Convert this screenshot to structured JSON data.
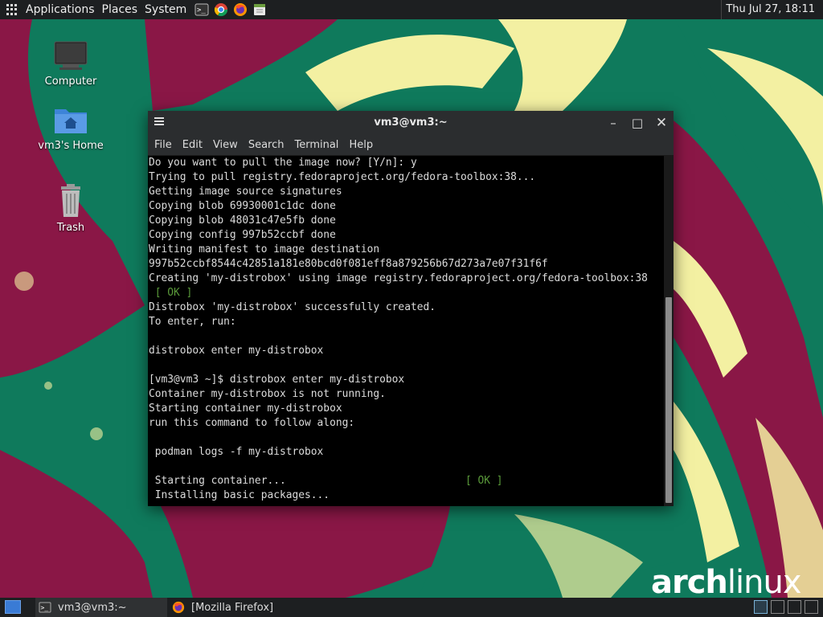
{
  "top_panel": {
    "menus": [
      "Applications",
      "Places",
      "System"
    ],
    "launchers": [
      "terminal-icon",
      "chrome-icon",
      "firefox-icon",
      "text-editor-icon"
    ],
    "clock": "Thu Jul 27, 18:11"
  },
  "desktop": {
    "icons": [
      {
        "label": "Computer",
        "icon": "computer-icon"
      },
      {
        "label": "vm3's Home",
        "icon": "home-folder-icon"
      },
      {
        "label": "Trash",
        "icon": "trash-icon"
      }
    ]
  },
  "terminal": {
    "title": "vm3@vm3:~",
    "menu": [
      "File",
      "Edit",
      "View",
      "Search",
      "Terminal",
      "Help"
    ],
    "lines": [
      "Do you want to pull the image now? [Y/n]: y",
      "Trying to pull registry.fedoraproject.org/fedora-toolbox:38...",
      "Getting image source signatures",
      "Copying blob 69930001c1dc done",
      "Copying blob 48031c47e5fb done",
      "Copying config 997b52ccbf done",
      "Writing manifest to image destination",
      "997b52ccbf8544c42851a181e80bcd0f081eff8a879256b67d273a7e07f31f6f",
      "Creating 'my-distrobox' using image registry.fedoraproject.org/fedora-toolbox:38",
      " [ OK ]",
      "Distrobox 'my-distrobox' successfully created.",
      "To enter, run:",
      "",
      "distrobox enter my-distrobox",
      "",
      "[vm3@vm3 ~]$ distrobox enter my-distrobox",
      "Container my-distrobox is not running.",
      "Starting container my-distrobox",
      "run this command to follow along:",
      "",
      " podman logs -f my-distrobox",
      "",
      " Starting container...",
      " Installing basic packages..."
    ],
    "ok_label": "[ OK ]"
  },
  "wallpaper": {
    "logo_bold": "arch",
    "logo_regular": "linux",
    "colors": {
      "green": "#0f7a5c",
      "maroon": "#8a1746",
      "cream": "#f3f0a2"
    }
  },
  "taskbar": {
    "tasks": [
      {
        "label": "vm3@vm3:~",
        "icon": "terminal-icon"
      },
      {
        "label": "[Mozilla Firefox]",
        "icon": "firefox-icon"
      }
    ],
    "workspaces": 4,
    "active_workspace": 1
  }
}
